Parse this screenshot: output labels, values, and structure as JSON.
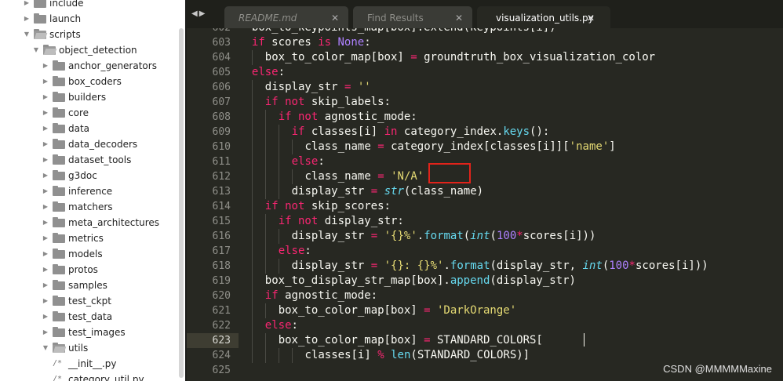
{
  "sidebar": {
    "items": [
      {
        "label": "include",
        "type": "folder",
        "state": "collapsed",
        "depth": 0
      },
      {
        "label": "launch",
        "type": "folder",
        "state": "collapsed",
        "depth": 0
      },
      {
        "label": "scripts",
        "type": "folder",
        "state": "expanded",
        "depth": 0
      },
      {
        "label": "object_detection",
        "type": "folder",
        "state": "expanded",
        "depth": 1
      },
      {
        "label": "anchor_generators",
        "type": "folder",
        "state": "collapsed",
        "depth": 2
      },
      {
        "label": "box_coders",
        "type": "folder",
        "state": "collapsed",
        "depth": 2
      },
      {
        "label": "builders",
        "type": "folder",
        "state": "collapsed",
        "depth": 2
      },
      {
        "label": "core",
        "type": "folder",
        "state": "collapsed",
        "depth": 2
      },
      {
        "label": "data",
        "type": "folder",
        "state": "collapsed",
        "depth": 2
      },
      {
        "label": "data_decoders",
        "type": "folder",
        "state": "collapsed",
        "depth": 2
      },
      {
        "label": "dataset_tools",
        "type": "folder",
        "state": "collapsed",
        "depth": 2
      },
      {
        "label": "g3doc",
        "type": "folder",
        "state": "collapsed",
        "depth": 2
      },
      {
        "label": "inference",
        "type": "folder",
        "state": "collapsed",
        "depth": 2
      },
      {
        "label": "matchers",
        "type": "folder",
        "state": "collapsed",
        "depth": 2
      },
      {
        "label": "meta_architectures",
        "type": "folder",
        "state": "collapsed",
        "depth": 2
      },
      {
        "label": "metrics",
        "type": "folder",
        "state": "collapsed",
        "depth": 2
      },
      {
        "label": "models",
        "type": "folder",
        "state": "collapsed",
        "depth": 2
      },
      {
        "label": "protos",
        "type": "folder",
        "state": "collapsed",
        "depth": 2
      },
      {
        "label": "samples",
        "type": "folder",
        "state": "collapsed",
        "depth": 2
      },
      {
        "label": "test_ckpt",
        "type": "folder",
        "state": "collapsed",
        "depth": 2
      },
      {
        "label": "test_data",
        "type": "folder",
        "state": "collapsed",
        "depth": 2
      },
      {
        "label": "test_images",
        "type": "folder",
        "state": "collapsed",
        "depth": 2
      },
      {
        "label": "utils",
        "type": "folder",
        "state": "expanded",
        "depth": 2
      },
      {
        "label": "__init__.py",
        "type": "file",
        "icon_text": "/*",
        "depth": 3
      },
      {
        "label": "category_util.py",
        "type": "file",
        "icon_text": "/*",
        "depth": 3
      }
    ]
  },
  "tabbar": {
    "nav_prev": "◀",
    "nav_next": "▶",
    "tabs": [
      {
        "label": "README.md",
        "close": "✕",
        "active": false,
        "italic": true
      },
      {
        "label": "Find Results",
        "close": "✕",
        "active": false,
        "italic": false
      },
      {
        "label": "visualization_utils.py",
        "close": "✕",
        "active": true,
        "italic": false
      }
    ]
  },
  "editor": {
    "current_line": "623",
    "lines": [
      {
        "n": "602",
        "indent": 1,
        "tokens": [
          [
            "box_to_keypoints_map[box].extend(keypoints[i])",
            ""
          ]
        ]
      },
      {
        "n": "603",
        "indent": 1,
        "tokens": [
          [
            "if",
            "kw"
          ],
          [
            " scores ",
            ""
          ],
          [
            "is",
            "kw"
          ],
          [
            " ",
            ""
          ],
          [
            "None",
            "nu"
          ],
          [
            ":",
            ""
          ]
        ]
      },
      {
        "n": "604",
        "indent": 2,
        "tokens": [
          [
            "box_to_color_map[box] ",
            ""
          ],
          [
            "=",
            "kw"
          ],
          [
            " groundtruth_box_visualization_color",
            ""
          ]
        ]
      },
      {
        "n": "605",
        "indent": 1,
        "tokens": [
          [
            "else",
            "kw"
          ],
          [
            ":",
            ""
          ]
        ]
      },
      {
        "n": "606",
        "indent": 2,
        "tokens": [
          [
            "display_str ",
            ""
          ],
          [
            "=",
            "kw"
          ],
          [
            " ",
            ""
          ],
          [
            "''",
            "st"
          ]
        ]
      },
      {
        "n": "607",
        "indent": 2,
        "tokens": [
          [
            "if",
            "kw"
          ],
          [
            " ",
            ""
          ],
          [
            "not",
            "kw"
          ],
          [
            " skip_labels:",
            ""
          ]
        ]
      },
      {
        "n": "608",
        "indent": 3,
        "tokens": [
          [
            "if",
            "kw"
          ],
          [
            " ",
            ""
          ],
          [
            "not",
            "kw"
          ],
          [
            " agnostic_mode:",
            ""
          ]
        ]
      },
      {
        "n": "609",
        "indent": 4,
        "tokens": [
          [
            "if",
            "kw"
          ],
          [
            " classes[i] ",
            ""
          ],
          [
            "in",
            "kw"
          ],
          [
            " category_index.",
            ""
          ],
          [
            "keys",
            "fn"
          ],
          [
            "():",
            ""
          ]
        ]
      },
      {
        "n": "610",
        "indent": 5,
        "tokens": [
          [
            "class_name ",
            ""
          ],
          [
            "=",
            "kw"
          ],
          [
            " category_index[classes[i]][",
            ""
          ],
          [
            "'name'",
            "st"
          ],
          [
            "]",
            ""
          ]
        ]
      },
      {
        "n": "611",
        "indent": 4,
        "tokens": [
          [
            "else",
            "kw"
          ],
          [
            ":",
            ""
          ]
        ]
      },
      {
        "n": "612",
        "indent": 5,
        "tokens": [
          [
            "class_name ",
            ""
          ],
          [
            "=",
            "kw"
          ],
          [
            " ",
            ""
          ],
          [
            "'N/A'",
            "st"
          ]
        ]
      },
      {
        "n": "613",
        "indent": 4,
        "tokens": [
          [
            "display_str ",
            ""
          ],
          [
            "=",
            "kw"
          ],
          [
            " ",
            ""
          ],
          [
            "str",
            "fi"
          ],
          [
            "(class_name)",
            ""
          ]
        ]
      },
      {
        "n": "614",
        "indent": 2,
        "tokens": [
          [
            "if",
            "kw"
          ],
          [
            " ",
            ""
          ],
          [
            "not",
            "kw"
          ],
          [
            " skip_scores:",
            ""
          ]
        ]
      },
      {
        "n": "615",
        "indent": 3,
        "tokens": [
          [
            "if",
            "kw"
          ],
          [
            " ",
            ""
          ],
          [
            "not",
            "kw"
          ],
          [
            " display_str:",
            ""
          ]
        ]
      },
      {
        "n": "616",
        "indent": 4,
        "tokens": [
          [
            "display_str ",
            ""
          ],
          [
            "=",
            "kw"
          ],
          [
            " ",
            ""
          ],
          [
            "'{}%'",
            "st"
          ],
          [
            ".",
            ""
          ],
          [
            "format",
            "fn"
          ],
          [
            "(",
            ""
          ],
          [
            "int",
            "fi"
          ],
          [
            "(",
            ""
          ],
          [
            "100",
            "nu"
          ],
          [
            "*",
            "kw"
          ],
          [
            "scores[i]))",
            ""
          ]
        ]
      },
      {
        "n": "617",
        "indent": 3,
        "tokens": [
          [
            "else",
            "kw"
          ],
          [
            ":",
            ""
          ]
        ]
      },
      {
        "n": "618",
        "indent": 4,
        "tokens": [
          [
            "display_str ",
            ""
          ],
          [
            "=",
            "kw"
          ],
          [
            " ",
            ""
          ],
          [
            "'{}: {}%'",
            "st"
          ],
          [
            ".",
            ""
          ],
          [
            "format",
            "fn"
          ],
          [
            "(display_str, ",
            ""
          ],
          [
            "int",
            "fi"
          ],
          [
            "(",
            ""
          ],
          [
            "100",
            "nu"
          ],
          [
            "*",
            "kw"
          ],
          [
            "scores[i]))",
            ""
          ]
        ]
      },
      {
        "n": "619",
        "indent": 2,
        "tokens": [
          [
            "box_to_display_str_map[box].",
            ""
          ],
          [
            "append",
            "fn"
          ],
          [
            "(display_str)",
            ""
          ]
        ]
      },
      {
        "n": "620",
        "indent": 2,
        "tokens": [
          [
            "if",
            "kw"
          ],
          [
            " agnostic_mode:",
            ""
          ]
        ]
      },
      {
        "n": "621",
        "indent": 3,
        "tokens": [
          [
            "box_to_color_map[box] ",
            ""
          ],
          [
            "=",
            "kw"
          ],
          [
            " ",
            ""
          ],
          [
            "'DarkOrange'",
            "st"
          ]
        ]
      },
      {
        "n": "622",
        "indent": 2,
        "tokens": [
          [
            "else",
            "kw"
          ],
          [
            ":",
            ""
          ]
        ]
      },
      {
        "n": "623",
        "indent": 3,
        "tokens": [
          [
            "box_to_color_map[box] ",
            ""
          ],
          [
            "=",
            "kw"
          ],
          [
            " STANDARD_COLORS[",
            ""
          ]
        ]
      },
      {
        "n": "624",
        "indent": 5,
        "tokens": [
          [
            "classes[i] ",
            ""
          ],
          [
            "%",
            "kw"
          ],
          [
            " ",
            ""
          ],
          [
            "len",
            "fn"
          ],
          [
            "(STANDARD_COLORS)]",
            ""
          ]
        ]
      },
      {
        "n": "625",
        "indent": 0,
        "tokens": []
      }
    ]
  },
  "watermark": "CSDN @MMMMMaxine",
  "colors": {
    "editor_bg": "#272822",
    "keyword": "#f92672",
    "string": "#e6db74",
    "number": "#ae81ff",
    "function": "#66d9ef",
    "highlight_box": "#e2231a"
  }
}
